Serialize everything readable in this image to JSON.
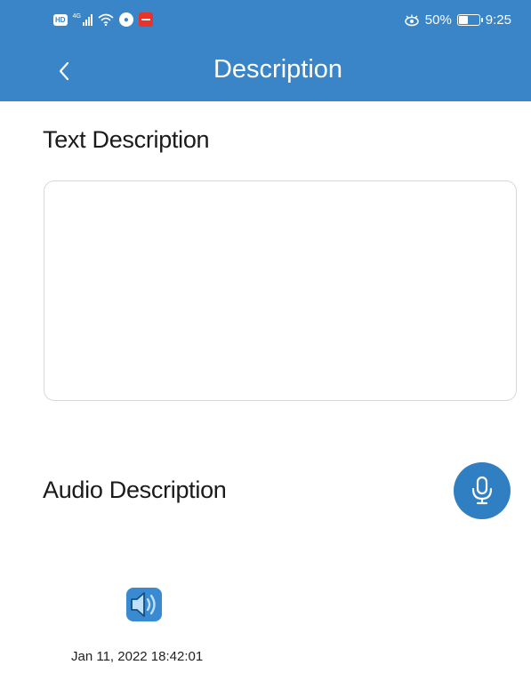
{
  "status_bar": {
    "hd_badge": "HD",
    "network": "4G",
    "battery_level": "50%",
    "time": "9:25",
    "icons": [
      "hd-icon",
      "cellular-signal-icon",
      "wifi-icon",
      "bulb-icon",
      "red-app-icon",
      "eye-comfort-icon",
      "battery-icon"
    ]
  },
  "header": {
    "title": "Description",
    "back_icon": "chevron-left-icon",
    "color": "#3a85c8"
  },
  "text_section": {
    "title": "Text Description",
    "input_value": "",
    "input_placeholder": ""
  },
  "audio_section": {
    "title": "Audio Description",
    "record_icon": "microphone-icon",
    "recordings": [
      {
        "icon": "speaker-icon",
        "timestamp": "Jan 11, 2022 18:42:01"
      }
    ],
    "accent_color": "#2f7fc2"
  }
}
